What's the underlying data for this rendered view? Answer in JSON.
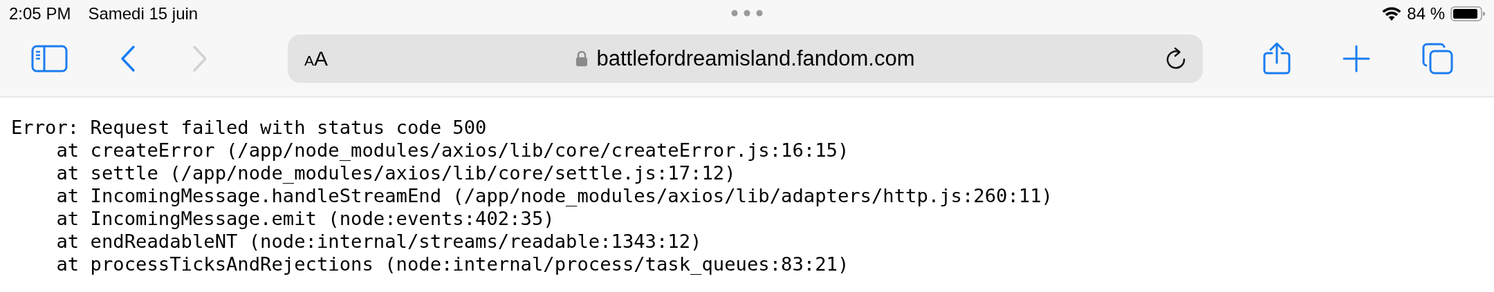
{
  "status_bar": {
    "time": "2:05 PM",
    "date": "Samedi 15 juin",
    "battery": "84 %"
  },
  "toolbar": {
    "back": {
      "disabled": false
    },
    "forward": {
      "disabled": true
    }
  },
  "address_bar": {
    "text_size_button": "AA",
    "url": "battlefordreamisland.fandom.com"
  },
  "error_lines": [
    "Error: Request failed with status code 500",
    "    at createError (/app/node_modules/axios/lib/core/createError.js:16:15)",
    "    at settle (/app/node_modules/axios/lib/core/settle.js:17:12)",
    "    at IncomingMessage.handleStreamEnd (/app/node_modules/axios/lib/adapters/http.js:260:11)",
    "    at IncomingMessage.emit (node:events:402:35)",
    "    at endReadableNT (node:internal/streams/readable:1343:12)",
    "    at processTicksAndRejections (node:internal/process/task_queues:83:21)"
  ]
}
